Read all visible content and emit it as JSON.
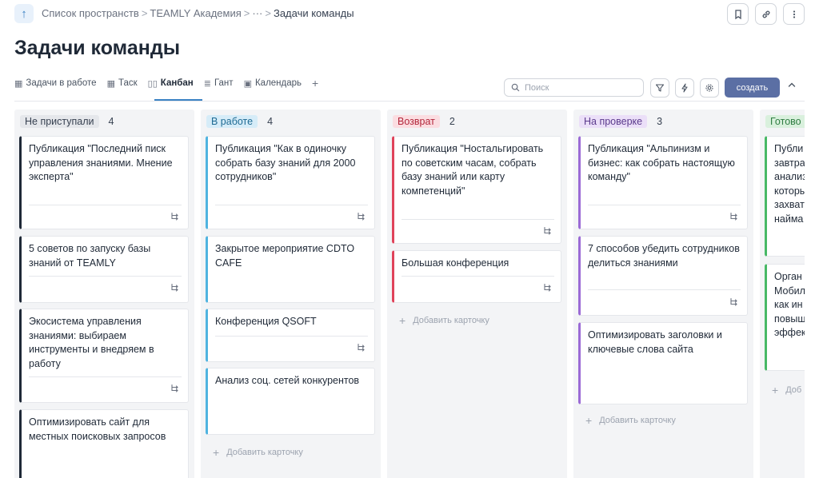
{
  "breadcrumb": {
    "items": [
      "Список пространств",
      "TEAMLY Академия",
      "···",
      "Задачи команды"
    ],
    "separator": ">"
  },
  "page": {
    "title": "Задачи команды"
  },
  "tabs": [
    {
      "label": "Задачи в работе",
      "icon": "table-icon"
    },
    {
      "label": "Таск",
      "icon": "table-icon"
    },
    {
      "label": "Канбан",
      "icon": "kanban-icon",
      "active": true
    },
    {
      "label": "Гант",
      "icon": "gantt-icon"
    },
    {
      "label": "Календарь",
      "icon": "calendar-icon"
    }
  ],
  "tab_add": "+",
  "search": {
    "placeholder": "Поиск"
  },
  "toolbar": {
    "create_label": "создать"
  },
  "add_card_label": "Добавить карточку",
  "colors": {
    "accent": "#3b82c4",
    "create_button": "#5b6fa4",
    "not_started": "#1f2937",
    "in_progress": "#4fb3e0",
    "returned": "#e0435a",
    "review": "#9b6bd6",
    "done": "#47b865"
  },
  "columns": [
    {
      "name": "Не приступали",
      "count": "4",
      "badge_bg": "#e5e7eb",
      "badge_fg": "#374151",
      "border": "#1f2937",
      "cards": [
        "Публикация \"Последний писк управления знаниями. Мнение эксперта\"",
        "5 советов по запуску базы знаний от TEAMLY",
        "Экосистема управления знаниями: выбираем инструменты и внедряем в работу",
        "Оптимизировать сайт для местных поисковых запросов"
      ]
    },
    {
      "name": "В работе",
      "count": "4",
      "badge_bg": "#d6ecf8",
      "badge_fg": "#1f6b94",
      "border": "#4fb3e0",
      "cards": [
        "Публикация \"Как в одиночку собрать базу знаний для 2000 сотрудников\"",
        "Закрытое мероприятие CDTO CAFE",
        "Конференция QSOFT",
        "Анализ соц. сетей конкурентов"
      ],
      "add_label": "Добавить карточку"
    },
    {
      "name": "Возврат",
      "count": "2",
      "badge_bg": "#fbdde1",
      "badge_fg": "#b3263b",
      "border": "#e0435a",
      "cards": [
        "Публикация \"Ностальгировать по советским часам, собрать базу знаний или карту компетенций\"",
        "Большая конференция"
      ],
      "add_label": "Добавить карточку"
    },
    {
      "name": "На проверке",
      "count": "3",
      "badge_bg": "#ebdff8",
      "badge_fg": "#5b3a8c",
      "border": "#9b6bd6",
      "cards": [
        "Публикация \"Альпинизм и бизнес: как собрать настоящую команду\"",
        "7 способов убедить сотрудников делиться знаниями",
        "Оптимизировать заголовки и ключевые слова сайта"
      ],
      "add_label": "Добавить карточку"
    },
    {
      "name": "Готово",
      "count": "",
      "badge_bg": "#d9f0dd",
      "badge_fg": "#2f7d42",
      "border": "#47b865",
      "cards": [
        "Публи завтра анализ которы захват найма",
        "Орган Мобил как ин повыш эффект"
      ],
      "add_label": "Доб"
    }
  ]
}
